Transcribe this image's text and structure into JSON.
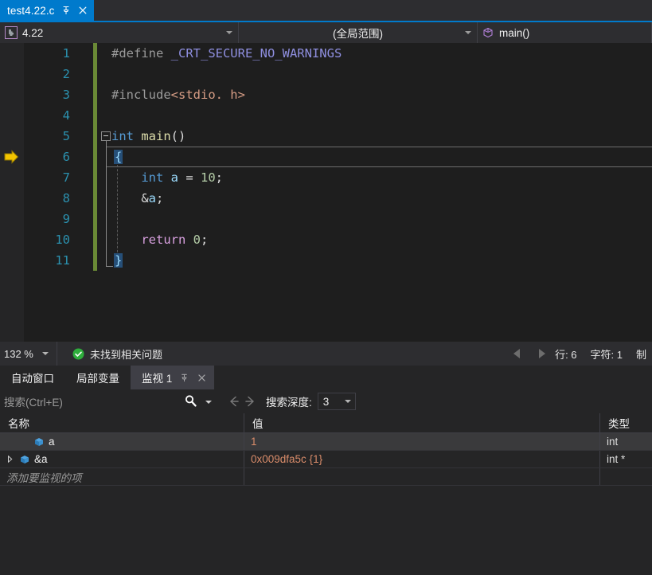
{
  "window": {
    "document_tab": {
      "title": "test4.22.c",
      "pin_icon": "pin-icon",
      "close_icon": "close-icon"
    }
  },
  "navbar": {
    "project": "4.22",
    "project_icon": "project-icon",
    "scope": "(全局范围)",
    "function": "main()",
    "function_icon": "method-cube-icon",
    "dropdown_icon": "chevron-down-icon"
  },
  "editor": {
    "current_line": 6,
    "exec_arrow_icon": "execution-pointer-icon",
    "lines": [
      {
        "no": "1",
        "tokens": [
          {
            "t": "#define ",
            "c": "t-pre"
          },
          {
            "t": "_CRT_SECURE_NO_WARNINGS",
            "c": "t-macro"
          }
        ]
      },
      {
        "no": "2",
        "tokens": []
      },
      {
        "no": "3",
        "tokens": [
          {
            "t": "#include",
            "c": "t-pre"
          },
          {
            "t": "<stdio. h>",
            "c": "t-str"
          }
        ]
      },
      {
        "no": "4",
        "tokens": []
      },
      {
        "no": "5",
        "tokens": [
          {
            "t": "int ",
            "c": "t-kw"
          },
          {
            "t": "main",
            "c": "t-fn"
          },
          {
            "t": "()",
            "c": "t-pun"
          }
        ]
      },
      {
        "no": "6",
        "tokens": []
      },
      {
        "no": "7",
        "tokens": [
          {
            "t": "    ",
            "c": "t-pun"
          },
          {
            "t": "int ",
            "c": "t-kw"
          },
          {
            "t": "a",
            "c": "t-var"
          },
          {
            "t": " = ",
            "c": "t-pun"
          },
          {
            "t": "10",
            "c": "t-num"
          },
          {
            "t": ";",
            "c": "t-pun"
          }
        ]
      },
      {
        "no": "8",
        "tokens": [
          {
            "t": "    ",
            "c": "t-pun"
          },
          {
            "t": "&",
            "c": "t-pun"
          },
          {
            "t": "a",
            "c": "t-var"
          },
          {
            "t": ";",
            "c": "t-pun"
          }
        ]
      },
      {
        "no": "9",
        "tokens": []
      },
      {
        "no": "10",
        "tokens": [
          {
            "t": "    ",
            "c": "t-pun"
          },
          {
            "t": "return ",
            "c": "t-kw2"
          },
          {
            "t": "0",
            "c": "t-num"
          },
          {
            "t": ";",
            "c": "t-pun"
          }
        ]
      },
      {
        "no": "11",
        "tokens": []
      }
    ],
    "open_brace": "{",
    "close_brace": "}"
  },
  "statusbar": {
    "zoom": "132 %",
    "issue_status": "未找到相关问题",
    "ok_icon": "check-circle-icon",
    "prev_icon": "triangle-left-icon",
    "next_icon": "triangle-right-icon",
    "line_label": "行: 6",
    "char_label": "字符: 1",
    "extra_label": "制"
  },
  "watch": {
    "tabs": [
      {
        "label": "自动窗口",
        "active": false
      },
      {
        "label": "局部变量",
        "active": false
      },
      {
        "label": "监视 1",
        "active": true
      }
    ],
    "active_tab_pin_icon": "pin-icon",
    "active_tab_close_icon": "close-icon",
    "search": {
      "placeholder": "搜索(Ctrl+E)",
      "search_icon": "search-icon",
      "dropdown_icon": "chevron-down-icon",
      "prev_icon": "arrow-left-icon",
      "next_icon": "arrow-right-icon",
      "depth_label": "搜索深度:",
      "depth_value": "3"
    },
    "columns": [
      "名称",
      "值",
      "类型"
    ],
    "rows": [
      {
        "name": "a",
        "value": "1",
        "type": "int",
        "selected": true,
        "expandable": false,
        "icon": "variable-icon"
      },
      {
        "name": "&a",
        "value": "0x009dfa5c {1}",
        "type": "int *",
        "selected": false,
        "expandable": true,
        "icon": "variable-icon"
      }
    ],
    "add_item_placeholder": "添加要监视的项"
  },
  "colors": {
    "accent_blue": "#007acc",
    "panel": "#2d2d30",
    "editor_bg": "#1e1e1e",
    "value_orange": "#d98c6a",
    "changebar_green": "#6a8a36",
    "exec_arrow_yellow": "#f2c400"
  }
}
